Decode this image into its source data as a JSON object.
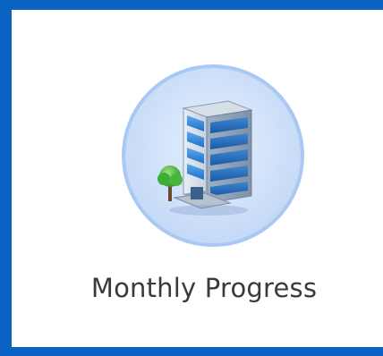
{
  "tile": {
    "label": "Monthly Progress",
    "icon": "office-building-icon",
    "accent_color": "#0b63c4",
    "circle_color": "#bcd4f6"
  }
}
